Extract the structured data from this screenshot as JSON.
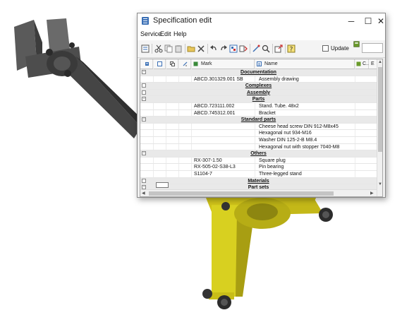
{
  "window": {
    "title": "Specification edit",
    "controls": {
      "minimize": "─",
      "maximize": "☐",
      "close": "✕"
    }
  },
  "menu": [
    "Service",
    "Edit",
    "Help"
  ],
  "toolbar": {
    "icons": [
      "specification-icon",
      "cut-icon",
      "copy-icon",
      "paste-icon",
      "open-folder-icon",
      "delete-icon",
      "undo-icon",
      "redo-icon",
      "properties-icon",
      "sort-icon",
      "link-icon",
      "search-icon",
      "export-icon",
      "help-icon"
    ],
    "update_label": "Update",
    "update_checked": false
  },
  "grid": {
    "columns": {
      "mark": "Mark",
      "name": "Name",
      "c": "C..",
      "e": "E"
    },
    "rows": [
      {
        "type": "section",
        "title": "Documentation",
        "expander": "−"
      },
      {
        "type": "item",
        "mark": "ABCD.301329.001 SB",
        "name": "Assembly drawing"
      },
      {
        "type": "section",
        "title": "Complexes",
        "expander": ""
      },
      {
        "type": "section",
        "title": "Assembly",
        "expander": ""
      },
      {
        "type": "section",
        "title": "Parts",
        "expander": "−"
      },
      {
        "type": "item",
        "mark": "ABCD.723111.002",
        "name": "Stand. Tube. 48x2"
      },
      {
        "type": "item",
        "mark": "ABCD.745312.001",
        "name": "Bracket"
      },
      {
        "type": "section",
        "title": "Standard parts",
        "expander": "−"
      },
      {
        "type": "item",
        "mark": "",
        "name": "Cheese head screw DIN 912-M8x45"
      },
      {
        "type": "item",
        "mark": "",
        "name": "Hexagonal nut 934-M16"
      },
      {
        "type": "item",
        "mark": "",
        "name": "Washer DIN 125-2-B M8.4"
      },
      {
        "type": "item",
        "mark": "",
        "name": "Hexagonal nut with stopper 7040-M8"
      },
      {
        "type": "section",
        "title": "Others",
        "expander": "−"
      },
      {
        "type": "item",
        "mark": "RX-307-1.50",
        "name": "Square plug"
      },
      {
        "type": "item",
        "mark": "RX-505-02-S38-L3",
        "name": "Pin bearing"
      },
      {
        "type": "item",
        "mark": "S1104-7",
        "name": "Three-legged stand"
      },
      {
        "type": "section",
        "title": "Materials",
        "expander": ""
      },
      {
        "type": "section",
        "title": "Part sets",
        "expander": "−"
      }
    ]
  },
  "colors": {
    "model_yellow": "#d8d020",
    "model_gray": "#4a4a4a",
    "window_bg": "#f0f0f0",
    "accent": "#3a6fb5"
  }
}
